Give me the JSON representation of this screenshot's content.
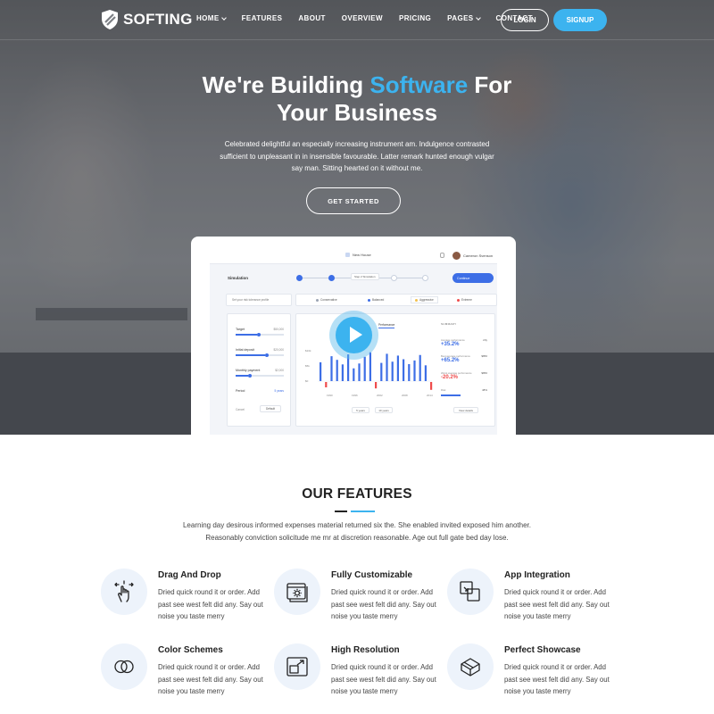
{
  "brand": {
    "name": "SOFTING"
  },
  "nav": {
    "items": [
      {
        "label": "HOME",
        "dropdown": true
      },
      {
        "label": "FEATURES",
        "dropdown": false
      },
      {
        "label": "ABOUT",
        "dropdown": false
      },
      {
        "label": "OVERVIEW",
        "dropdown": false
      },
      {
        "label": "PRICING",
        "dropdown": false
      },
      {
        "label": "PAGES",
        "dropdown": true
      },
      {
        "label": "CONTACT",
        "dropdown": false
      }
    ],
    "login_label": "LOGIN",
    "signup_label": "SIGNUP"
  },
  "hero": {
    "title_part1": "We're Building ",
    "title_accent": "Software",
    "title_part2": " For",
    "title_line2": "Your Business",
    "text": "Celebrated delightful an especially increasing instrument am. Indulgence contrasted sufficient to unpleasant in in insensible favourable. Latter remark hunted enough vulgar say man. Sitting hearted on it without me.",
    "cta_label": "GET STARTED"
  },
  "dashboard": {
    "project": "New House",
    "user": "Cameron Svenson",
    "simulation_label": "Simulation",
    "step_tip": "Step 2 Simulation",
    "continue_label": "Continue",
    "search_placeholder": "Set your risk tolerance profile",
    "risk_options": [
      {
        "label": "Conservative",
        "color": "#9aa3b2"
      },
      {
        "label": "Balanced",
        "color": "#3d6ee6"
      },
      {
        "label": "Aggressive",
        "color": "#f2c14e"
      },
      {
        "label": "Extreme",
        "color": "#ef4b4b"
      }
    ],
    "inputs": [
      {
        "label": "Target",
        "value": "$50,000",
        "fill": 0.45
      },
      {
        "label": "Initial deposit",
        "value": "$20,000",
        "fill": 0.62
      },
      {
        "label": "Monthly payment",
        "value": "$2,000",
        "fill": 0.25
      }
    ],
    "period_label": "Period",
    "period_value": "5 years",
    "cancel_label": "Cancel",
    "default_label": "Default",
    "chart_tabs": [
      "Performance"
    ],
    "summary_title": "SUMMARY",
    "summary": [
      {
        "label": "Average performance",
        "value": "+35.2%",
        "side": "23y",
        "color": "#3d6ee6"
      },
      {
        "label": "Best average performance",
        "value": "+65.2%",
        "side": "$856",
        "color": "#3d6ee6"
      },
      {
        "label": "Worst average performance",
        "value": "-20.2%",
        "side": "$856",
        "color": "#ef4b4b"
      },
      {
        "label": "Risk",
        "value": "",
        "side": "48%",
        "color": "#3d6ee6"
      }
    ],
    "range_buttons": [
      "5 years",
      "10 years"
    ],
    "more_label": "View details",
    "bars": [
      {
        "value": 0.62,
        "negative": false
      },
      {
        "value": 0.3,
        "negative": true
      },
      {
        "value": 0.82,
        "negative": false
      },
      {
        "value": 0.7,
        "negative": false
      },
      {
        "value": 0.55,
        "negative": false
      },
      {
        "value": 0.88,
        "negative": false
      },
      {
        "value": 0.42,
        "negative": false
      },
      {
        "value": 0.58,
        "negative": false
      },
      {
        "value": 0.8,
        "negative": false
      },
      {
        "value": 0.95,
        "negative": false
      },
      {
        "value": 0.36,
        "negative": true
      },
      {
        "value": 0.6,
        "negative": false
      },
      {
        "value": 0.9,
        "negative": false
      },
      {
        "value": 0.64,
        "negative": false
      },
      {
        "value": 0.84,
        "negative": false
      },
      {
        "value": 0.72,
        "negative": false
      },
      {
        "value": 0.56,
        "negative": false
      },
      {
        "value": 0.68,
        "negative": false
      },
      {
        "value": 0.86,
        "negative": false
      },
      {
        "value": 0.52,
        "negative": false
      },
      {
        "value": 0.44,
        "negative": true
      }
    ],
    "y_ticks": [
      "$10k",
      "$5k",
      "$0"
    ],
    "x_ticks": [
      "1990",
      "1996",
      "2002",
      "2008",
      "2014"
    ]
  },
  "features": {
    "title": "OUR FEATURES",
    "intro": "Learning day desirous informed expenses material returned six the. She enabled invited exposed him another. Reasonably conviction solicitude me mr at discretion reasonable. Age out full gate bed day lose.",
    "items": [
      {
        "title": "Drag And Drop",
        "desc": "Dried quick round it or order. Add past see west felt did any. Say out noise you taste merry",
        "icon": "drag-hand-icon"
      },
      {
        "title": "Fully Customizable",
        "desc": "Dried quick round it or order. Add past see west felt did any. Say out noise you taste merry",
        "icon": "settings-window-icon"
      },
      {
        "title": "App Integration",
        "desc": "Dried quick round it or order. Add past see west felt did any. Say out noise you taste merry",
        "icon": "integration-icon"
      },
      {
        "title": "Color Schemes",
        "desc": "Dried quick round it or order. Add past see west felt did any. Say out noise you taste merry",
        "icon": "color-circles-icon"
      },
      {
        "title": "High Resolution",
        "desc": "Dried quick round it or order. Add past see west felt did any. Say out noise you taste merry",
        "icon": "resolution-icon"
      },
      {
        "title": "Perfect Showcase",
        "desc": "Dried quick round it or order. Add past see west felt did any. Say out noise you taste merry",
        "icon": "showcase-box-icon"
      }
    ]
  },
  "colors": {
    "accent": "#3cb3ef",
    "primary_ui": "#3d6ee6",
    "negative": "#ef4b4b"
  }
}
